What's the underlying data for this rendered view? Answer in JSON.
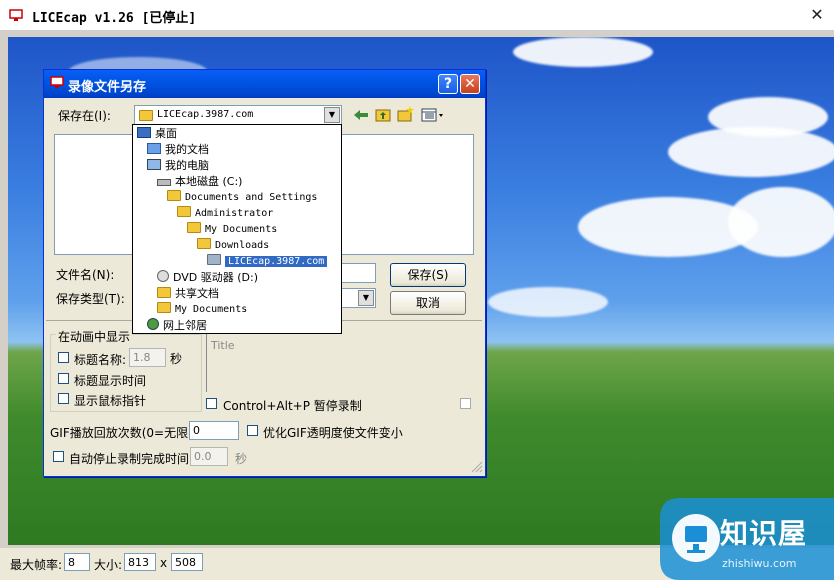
{
  "main_window": {
    "title": "LICEcap v1.26 [已停止]",
    "close_glyph": "✕"
  },
  "status_bar": {
    "max_fps_label": "最大帧率:",
    "max_fps_value": "8",
    "size_label": "大小:",
    "width_value": "813",
    "times": "x",
    "height_value": "508"
  },
  "dialog": {
    "title": "录像文件另存",
    "help_glyph": "?",
    "close_glyph": "✕",
    "save_in_label": "保存在(I):",
    "save_in_value": "LICEcap.3987.com",
    "filename_label": "文件名(N):",
    "filetype_label": "保存类型(T):",
    "save_button": "保存(S)",
    "cancel_button": "取消",
    "show_in_animation_label": "在动画中显示",
    "title_name_label": "标题名称:",
    "title_seconds_value": "1.8",
    "seconds_unit": "秒",
    "show_title_time_label": "标题显示时间",
    "show_cursor_label": "显示鼠标指针",
    "title_placeholder": "Title",
    "pause_shortcut_label": "Control+Alt+P 暂停录制",
    "gif_loop_label": "GIF播放回放次数(0=无限):",
    "gif_loop_value": "0",
    "optimize_label": "优化GIF透明度使文件变小",
    "auto_stop_label": "自动停止录制完成时间",
    "auto_stop_value": "0.0",
    "auto_stop_unit": "秒"
  },
  "location_dropdown": {
    "items": [
      {
        "label": "桌面",
        "icon": "desktop-icon"
      },
      {
        "label": "我的文档",
        "icon": "my-documents-icon"
      },
      {
        "label": "我的电脑",
        "icon": "my-computer-icon"
      },
      {
        "label": "本地磁盘 (C:)",
        "icon": "drive-icon"
      },
      {
        "label": "Documents and Settings",
        "icon": "folder-icon"
      },
      {
        "label": "Administrator",
        "icon": "folder-icon"
      },
      {
        "label": "My Documents",
        "icon": "folder-icon"
      },
      {
        "label": "Downloads",
        "icon": "folder-icon"
      },
      {
        "label": "LICEcap.3987.com",
        "icon": "folder-icon",
        "selected": true
      },
      {
        "label": "DVD 驱动器 (D:)",
        "icon": "dvd-drive-icon"
      },
      {
        "label": "共享文档",
        "icon": "folder-icon"
      },
      {
        "label": "My Documents",
        "icon": "folder-icon"
      },
      {
        "label": "网上邻居",
        "icon": "network-icon"
      }
    ]
  },
  "watermark": {
    "brand": "知识屋",
    "url": "zhishiwu.com"
  }
}
